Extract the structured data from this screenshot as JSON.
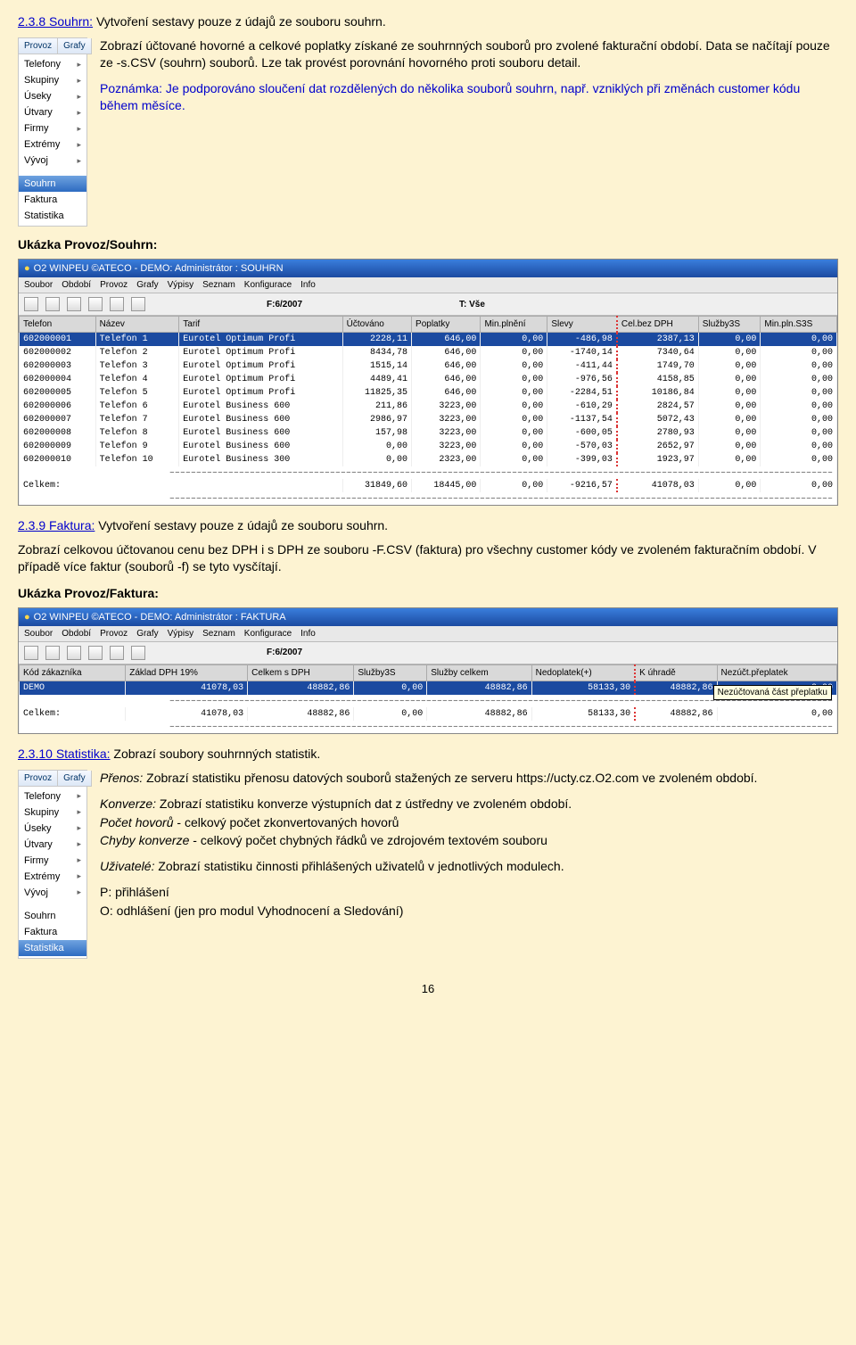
{
  "sec238": {
    "num": "2.3.8 Souhrn:",
    "rest": "Vytvoření sestavy pouze z údajů ze souboru souhrn.",
    "p1": "Zobrazí účtované hovorné a celkové poplatky získané ze souhrnných souborů pro zvolené fakturační období. Data se načítají pouze ze -s.CSV (souhrn) souborů. Lze tak provést porovnání hovorného proti souboru detail.",
    "note": "Poznámka: Je podporováno sloučení dat rozdělených do několika souborů souhrn, např. vzniklých při změnách customer kódu během měsíce."
  },
  "sidemenu1": {
    "tabs": [
      "Provoz",
      "Grafy"
    ],
    "items": [
      {
        "label": "Telefony",
        "arrow": true
      },
      {
        "label": "Skupiny",
        "arrow": true
      },
      {
        "label": "Úseky",
        "arrow": true
      },
      {
        "label": "Útvary",
        "arrow": true
      },
      {
        "label": "Firmy",
        "arrow": true
      },
      {
        "label": "Extrémy",
        "arrow": true
      },
      {
        "label": "Vývoj",
        "arrow": true
      }
    ],
    "items2": [
      {
        "label": "Souhrn",
        "selected": true
      },
      {
        "label": "Faktura"
      },
      {
        "label": "Statistika"
      }
    ]
  },
  "ukazka1_heading": "Ukázka Provoz/Souhrn:",
  "souhrn_title": "O2 WINPEU ©ATECO - DEMO: Administrátor : SOUHRN",
  "menubar": [
    "Soubor",
    "Období",
    "Provoz",
    "Grafy",
    "Výpisy",
    "Seznam",
    "Konfigurace",
    "Info"
  ],
  "tool_period": "F:6/2007",
  "tool_t": "T: Vše",
  "souhrn_headers": [
    "Telefon",
    "Název",
    "Tarif",
    "Účtováno",
    "Poplatky",
    "Min.plnění",
    "Slevy",
    "Cel.bez DPH",
    "Služby3S",
    "Min.pln.S3S"
  ],
  "souhrn_rows": [
    [
      "602000001",
      "Telefon 1",
      "Eurotel Optimum Profi",
      "2228,11",
      "646,00",
      "0,00",
      "-486,98",
      "2387,13",
      "0,00",
      "0,00"
    ],
    [
      "602000002",
      "Telefon 2",
      "Eurotel Optimum Profi",
      "8434,78",
      "646,00",
      "0,00",
      "-1740,14",
      "7340,64",
      "0,00",
      "0,00"
    ],
    [
      "602000003",
      "Telefon 3",
      "Eurotel Optimum Profi",
      "1515,14",
      "646,00",
      "0,00",
      "-411,44",
      "1749,70",
      "0,00",
      "0,00"
    ],
    [
      "602000004",
      "Telefon 4",
      "Eurotel Optimum Profi",
      "4489,41",
      "646,00",
      "0,00",
      "-976,56",
      "4158,85",
      "0,00",
      "0,00"
    ],
    [
      "602000005",
      "Telefon 5",
      "Eurotel Optimum Profi",
      "11825,35",
      "646,00",
      "0,00",
      "-2284,51",
      "10186,84",
      "0,00",
      "0,00"
    ],
    [
      "602000006",
      "Telefon 6",
      "Eurotel Business 600",
      "211,86",
      "3223,00",
      "0,00",
      "-610,29",
      "2824,57",
      "0,00",
      "0,00"
    ],
    [
      "602000007",
      "Telefon 7",
      "Eurotel Business 600",
      "2986,97",
      "3223,00",
      "0,00",
      "-1137,54",
      "5072,43",
      "0,00",
      "0,00"
    ],
    [
      "602000008",
      "Telefon 8",
      "Eurotel Business 600",
      "157,98",
      "3223,00",
      "0,00",
      "-600,05",
      "2780,93",
      "0,00",
      "0,00"
    ],
    [
      "602000009",
      "Telefon 9",
      "Eurotel Business 600",
      "0,00",
      "3223,00",
      "0,00",
      "-570,03",
      "2652,97",
      "0,00",
      "0,00"
    ],
    [
      "602000010",
      "Telefon 10",
      "Eurotel Business 300",
      "0,00",
      "2323,00",
      "0,00",
      "-399,03",
      "1923,97",
      "0,00",
      "0,00"
    ]
  ],
  "souhrn_total_label": "Celkem:",
  "souhrn_total": [
    "31849,60",
    "18445,00",
    "0,00",
    "-9216,57",
    "41078,03",
    "0,00",
    "0,00"
  ],
  "sec239": {
    "num": "2.3.9 Faktura:",
    "rest": "Vytvoření sestavy pouze z údajů ze souboru souhrn.",
    "p1": "Zobrazí celkovou účtovanou cenu bez DPH i s DPH ze souboru -F.CSV (faktura) pro všechny customer kódy ve zvoleném fakturačním období. V případě více faktur (souborů -f) se tyto vysčítají."
  },
  "ukazka2_heading": "Ukázka Provoz/Faktura:",
  "faktura_title": "O2 WINPEU ©ATECO - DEMO: Administrátor : FAKTURA",
  "faktura_headers": [
    "Kód zákazníka",
    "Základ DPH 19%",
    "Celkem s DPH",
    "Služby3S",
    "Služby celkem",
    "Nedoplatek(+)",
    "K úhradě",
    "Nezúčt.přeplatek"
  ],
  "faktura_rows": [
    [
      "DEMO",
      "41078,03",
      "48882,86",
      "0,00",
      "48882,86",
      "58133,30",
      "48882,86",
      "0,00"
    ]
  ],
  "faktura_total_label": "Celkem:",
  "faktura_total": [
    "41078,03",
    "48882,86",
    "0,00",
    "48882,86",
    "58133,30",
    "48882,86",
    "0,00"
  ],
  "faktura_tooltip": "Nezúčtovaná část přeplatku",
  "sec2310": {
    "num": "2.3.10 Statistika:",
    "rest": "Zobrazí soubory souhrnných statistik.",
    "p_prenos_label": "Přenos:",
    "p_prenos": " Zobrazí statistiku přenosu datových souborů stažených ze serveru https://ucty.cz.O2.com ve zvoleném období.",
    "p_konverze_label": "Konverze:",
    "p_konverze": " Zobrazí statistiku konverze výstupních dat z ústředny ve zvoleném období.",
    "p_pocet_label": "Počet hovorů",
    "p_pocet": " - celkový počet zkonvertovaných hovorů",
    "p_chyby_label": "Chyby konverze",
    "p_chyby": " - celkový počet chybných řádků ve zdrojovém textovém souboru",
    "p_uziv_label": "Uživatelé:",
    "p_uziv": " Zobrazí statistiku činnosti přihlášených uživatelů v jednotlivých modulech.",
    "p_p": "P: přihlášení",
    "p_o": "O: odhlášení (jen pro modul Vyhodnocení a Sledování)"
  },
  "sidemenu2": {
    "tabs": [
      "Provoz",
      "Grafy"
    ],
    "items": [
      {
        "label": "Telefony",
        "arrow": true
      },
      {
        "label": "Skupiny",
        "arrow": true
      },
      {
        "label": "Úseky",
        "arrow": true
      },
      {
        "label": "Útvary",
        "arrow": true
      },
      {
        "label": "Firmy",
        "arrow": true
      },
      {
        "label": "Extrémy",
        "arrow": true
      },
      {
        "label": "Vývoj",
        "arrow": true
      }
    ],
    "items2": [
      {
        "label": "Souhrn"
      },
      {
        "label": "Faktura"
      },
      {
        "label": "Statistika",
        "selected": true
      }
    ]
  },
  "page_number": "16"
}
